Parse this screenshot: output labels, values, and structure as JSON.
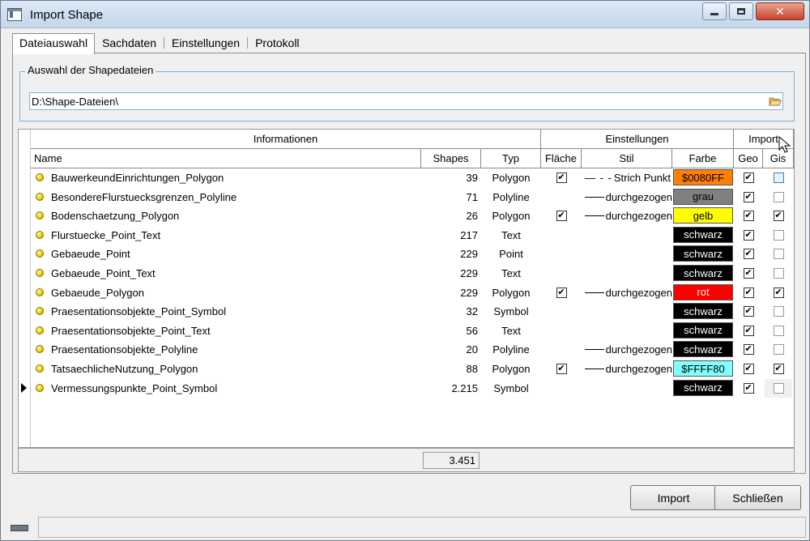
{
  "window": {
    "title": "Import Shape"
  },
  "tabs": [
    {
      "label": "Dateiauswahl",
      "active": true
    },
    {
      "label": "Sachdaten",
      "active": false
    },
    {
      "label": "Einstellungen",
      "active": false
    },
    {
      "label": "Protokoll",
      "active": false
    }
  ],
  "selection": {
    "group_label": "Auswahl der Shapedateien",
    "path_value": "D:\\Shape-Dateien\\"
  },
  "grid": {
    "group_headers": {
      "info": "Informationen",
      "settings": "Einstellungen",
      "import": "Import"
    },
    "columns": {
      "name": "Name",
      "shapes": "Shapes",
      "typ": "Typ",
      "flaeche": "Fläche",
      "stil": "Stil",
      "farbe": "Farbe",
      "geo": "Geo",
      "gis": "Gis"
    },
    "rows": [
      {
        "name": "BauwerkeundEinrichtungen_Polygon",
        "shapes": "39",
        "typ": "Polygon",
        "flaeche": true,
        "stil": "Strich Punkt",
        "stil_type": "dash",
        "farbe": "$0080FF",
        "farbe_bg": "#ff8000",
        "farbe_fg": "#000000",
        "geo": true,
        "gis": false
      },
      {
        "name": "BesondereFlurstuecksgrenzen_Polyline",
        "shapes": "71",
        "typ": "Polyline",
        "flaeche": false,
        "stil": "durchgezogen",
        "stil_type": "solid",
        "farbe": "grau",
        "farbe_bg": "#808080",
        "farbe_fg": "#000000",
        "geo": true,
        "gis": false
      },
      {
        "name": "Bodenschaetzung_Polygon",
        "shapes": "26",
        "typ": "Polygon",
        "flaeche": true,
        "stil": "durchgezogen",
        "stil_type": "solid",
        "farbe": "gelb",
        "farbe_bg": "#ffff00",
        "farbe_fg": "#000000",
        "geo": true,
        "gis": true
      },
      {
        "name": "Flurstuecke_Point_Text",
        "shapes": "217",
        "typ": "Text",
        "flaeche": false,
        "stil": "",
        "stil_type": "none",
        "farbe": "schwarz",
        "farbe_bg": "#000000",
        "farbe_fg": "#ffffff",
        "geo": true,
        "gis": false
      },
      {
        "name": "Gebaeude_Point",
        "shapes": "229",
        "typ": "Point",
        "flaeche": false,
        "stil": "",
        "stil_type": "none",
        "farbe": "schwarz",
        "farbe_bg": "#000000",
        "farbe_fg": "#ffffff",
        "geo": true,
        "gis": false
      },
      {
        "name": "Gebaeude_Point_Text",
        "shapes": "229",
        "typ": "Text",
        "flaeche": false,
        "stil": "",
        "stil_type": "none",
        "farbe": "schwarz",
        "farbe_bg": "#000000",
        "farbe_fg": "#ffffff",
        "geo": true,
        "gis": false
      },
      {
        "name": "Gebaeude_Polygon",
        "shapes": "229",
        "typ": "Polygon",
        "flaeche": true,
        "stil": "durchgezogen",
        "stil_type": "solid",
        "farbe": "rot",
        "farbe_bg": "#ff0000",
        "farbe_fg": "#ffffff",
        "geo": true,
        "gis": true
      },
      {
        "name": "Praesentationsobjekte_Point_Symbol",
        "shapes": "32",
        "typ": "Symbol",
        "flaeche": false,
        "stil": "",
        "stil_type": "none",
        "farbe": "schwarz",
        "farbe_bg": "#000000",
        "farbe_fg": "#ffffff",
        "geo": true,
        "gis": false
      },
      {
        "name": "Praesentationsobjekte_Point_Text",
        "shapes": "56",
        "typ": "Text",
        "flaeche": false,
        "stil": "",
        "stil_type": "none",
        "farbe": "schwarz",
        "farbe_bg": "#000000",
        "farbe_fg": "#ffffff",
        "geo": true,
        "gis": false
      },
      {
        "name": "Praesentationsobjekte_Polyline",
        "shapes": "20",
        "typ": "Polyline",
        "flaeche": false,
        "stil": "durchgezogen",
        "stil_type": "solid",
        "farbe": "schwarz",
        "farbe_bg": "#000000",
        "farbe_fg": "#ffffff",
        "geo": true,
        "gis": false
      },
      {
        "name": "TatsaechlicheNutzung_Polygon",
        "shapes": "88",
        "typ": "Polygon",
        "flaeche": true,
        "stil": "durchgezogen",
        "stil_type": "solid",
        "farbe": "$FFFF80",
        "farbe_bg": "#80ffff",
        "farbe_fg": "#000000",
        "geo": true,
        "gis": true
      },
      {
        "name": "Vermessungspunkte_Point_Symbol",
        "shapes": "2.215",
        "typ": "Symbol",
        "flaeche": false,
        "stil": "",
        "stil_type": "none",
        "farbe": "schwarz",
        "farbe_bg": "#000000",
        "farbe_fg": "#ffffff",
        "geo": true,
        "gis": false,
        "current": true
      }
    ],
    "total_shapes": "3.451"
  },
  "buttons": {
    "import": "Import",
    "close": "Schließen"
  },
  "icons": {
    "folder": "folder-open-icon",
    "row_status": "status-dot-icon",
    "row_pointer": "current-row-arrow-icon"
  }
}
